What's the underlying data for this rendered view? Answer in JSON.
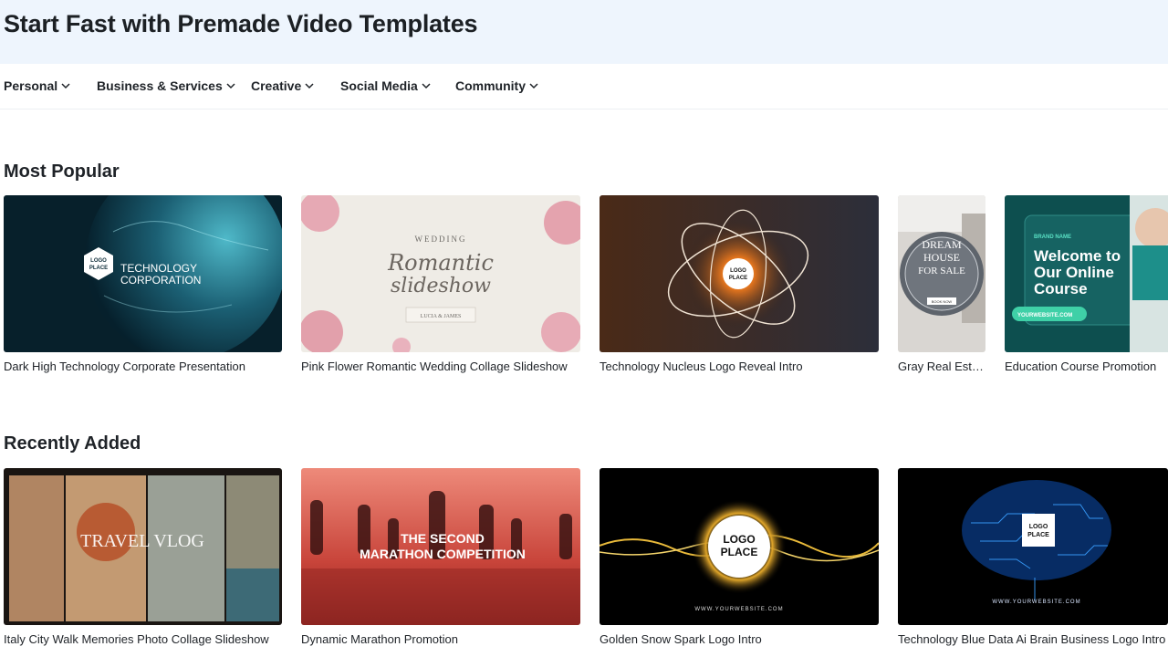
{
  "page": {
    "title": "Start Fast with Premade Video Templates"
  },
  "categories": [
    {
      "label": "Personal"
    },
    {
      "label": "Business & Services"
    },
    {
      "label": "Creative"
    },
    {
      "label": "Social Media"
    },
    {
      "label": "Community"
    }
  ],
  "sections": {
    "popular": {
      "title": "Most Popular",
      "items": [
        {
          "caption": "Dark High Technology Corporate Presentation",
          "thumb_text": [
            "LOGO",
            "PLACE",
            "TECHNOLOGY",
            "CORPORATION"
          ]
        },
        {
          "caption": "Pink Flower Romantic Wedding Collage Slideshow",
          "thumb_text": [
            "WEDDING",
            "Romantic",
            "slideshow",
            "LUCIA & JAMES"
          ]
        },
        {
          "caption": "Technology Nucleus Logo Reveal Intro",
          "thumb_text": [
            "LOGO",
            "PLACE"
          ]
        },
        {
          "caption": "Gray Real Estat...",
          "thumb_text": [
            "DREAM",
            "HOUSE",
            "FOR SALE",
            "BOOK NOW"
          ]
        },
        {
          "caption": "Education Course Promotion",
          "thumb_text": [
            "BRAND NAME",
            "Welcome to",
            "Our Online",
            "Course",
            "YOURWEBSITE.COM"
          ]
        }
      ]
    },
    "recent": {
      "title": "Recently Added",
      "items": [
        {
          "caption": "Italy City Walk Memories Photo Collage Slideshow",
          "thumb_text": [
            "TRAVEL VLOG"
          ]
        },
        {
          "caption": "Dynamic Marathon Promotion",
          "thumb_text": [
            "THE SECOND",
            "MARATHON COMPETITION"
          ]
        },
        {
          "caption": "Golden Snow Spark Logo Intro",
          "thumb_text": [
            "LOGO",
            "PLACE",
            "WWW.YOURWEBSITE.COM"
          ]
        },
        {
          "caption": "Technology Blue Data Ai Brain Business Logo Intro",
          "thumb_text": [
            "LOGO",
            "PLACE",
            "WWW.YOURWEBSITE.COM"
          ]
        }
      ]
    }
  },
  "colors": {
    "hero_bg": "#eef5fd",
    "text": "#1f2328"
  }
}
